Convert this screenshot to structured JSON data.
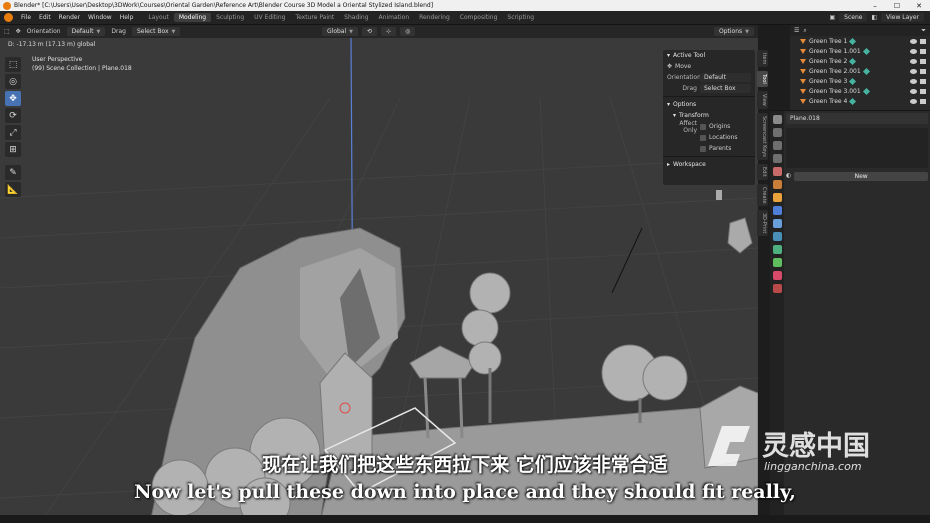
{
  "window": {
    "title": "Blender* [C:\\Users\\User\\Desktop\\3DWork\\Courses\\Oriental Garden\\Reference Art\\Blender Course 3D Model a Oriental Stylized Island.blend]"
  },
  "menu": [
    "File",
    "Edit",
    "Render",
    "Window",
    "Help"
  ],
  "workspaces": [
    "Layout",
    "Modeling",
    "Sculpting",
    "UV Editing",
    "Texture Paint",
    "Shading",
    "Animation",
    "Rendering",
    "Compositing",
    "Scripting"
  ],
  "active_workspace": "Modeling",
  "scene_label": "Scene",
  "view_layer_label": "View Layer",
  "tool_header": {
    "orientation_label": "Orientation",
    "orientation_value": "Default",
    "drag_label": "Drag",
    "drag_value": "Select Box",
    "global_value": "Global",
    "options_label": "Options"
  },
  "viewport": {
    "status_text": "D: -17.13 m (17.13 m) global",
    "perspective_label": "User Perspective",
    "collection_label": "(99) Scene Collection | Plane.018",
    "colors": {
      "background": "#3a3a3a",
      "grid": "#444444",
      "model": "#8f8f8f",
      "z_axis": "#5a7fd6",
      "selection": "#e8e8e8"
    }
  },
  "npanel": {
    "active_tool_title": "Active Tool",
    "tool_name": "Move",
    "orientation_label": "Orientation",
    "orientation_value": "Default",
    "drag_label": "Drag",
    "drag_value": "Select Box",
    "options_title": "Options",
    "transform_title": "Transform",
    "affect_only_label": "Affect Only",
    "affect_options": [
      "Origins",
      "Locations",
      "Parents"
    ],
    "workspace_title": "Workspace"
  },
  "sidebar_tabs": [
    "Item",
    "Tool",
    "View",
    "Screencast Keys",
    "Edit",
    "Create",
    "3D-Print"
  ],
  "outliner": {
    "rows": [
      "Green Tree 1",
      "Green Tree 1.001",
      "Green Tree 2",
      "Green Tree 2.001",
      "Green Tree 3",
      "Green Tree 3.001",
      "Green Tree 4"
    ]
  },
  "properties": {
    "object_name": "Plane.018",
    "new_button": "New"
  },
  "subtitles": {
    "chinese": "现在让我们把这些东西拉下来 它们应该非常合适",
    "english": "Now let's pull these down into place and they should fit really,"
  },
  "watermark": {
    "brand_cn": "灵感中国",
    "url": "lingganchina.com"
  }
}
